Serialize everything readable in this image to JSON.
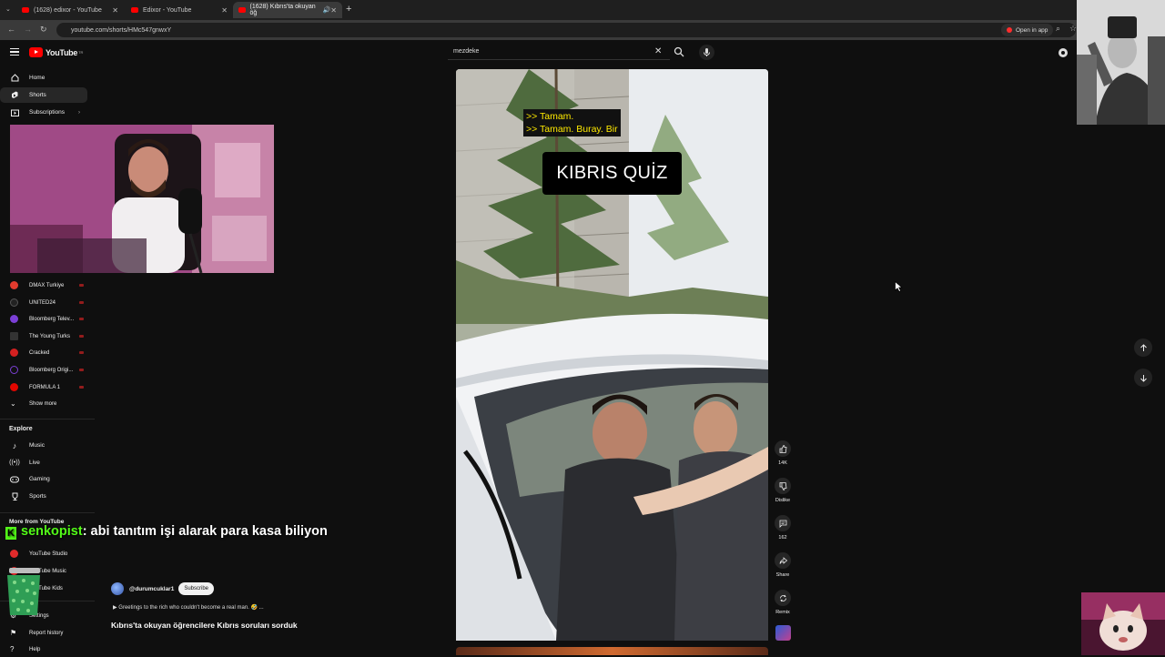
{
  "browser": {
    "tabs": [
      {
        "label": "(1628) edixor - YouTube"
      },
      {
        "label": "Edixor - YouTube"
      },
      {
        "label": "(1628) Kıbrıs'ta okuyan öğ"
      }
    ],
    "url": "youtube.com/shorts/HMc547gnwxY",
    "open_in_app": "Open in app"
  },
  "header": {
    "logo": "YouTube",
    "logo_region": "TR",
    "search_value": "mezdeke"
  },
  "sidebar": {
    "main": [
      {
        "label": "Home",
        "icon": "home-icon"
      },
      {
        "label": "Shorts",
        "icon": "shorts-icon"
      },
      {
        "label": "Subscriptions",
        "icon": "subscriptions-icon"
      }
    ],
    "subscriptions": [
      {
        "label": "DMAX Turkiye",
        "color": "#e23b2e"
      },
      {
        "label": "UNITED24",
        "color": "#222222"
      },
      {
        "label": "Bloomberg Telev...",
        "color": "#7b3fd6"
      },
      {
        "label": "The Young Turks",
        "color": "#333333"
      },
      {
        "label": "Cracked",
        "color": "#d32020"
      },
      {
        "label": "Bloomberg Origi...",
        "color": "#111111"
      },
      {
        "label": "FORMULA 1",
        "color": "#e10600"
      }
    ],
    "show_more": "Show more",
    "explore_heading": "Explore",
    "explore": [
      {
        "label": "Music",
        "icon": "music-icon"
      },
      {
        "label": "Live",
        "icon": "live-icon"
      },
      {
        "label": "Gaming",
        "icon": "gaming-icon"
      },
      {
        "label": "Sports",
        "icon": "trophy-icon"
      }
    ],
    "more_heading": "More from YouTube",
    "more": [
      {
        "label": "YouTube Studio"
      },
      {
        "label": "YouTube Music"
      },
      {
        "label": "YouTube Kids"
      }
    ],
    "settings": "Settings",
    "report_history": "Report history",
    "help": "Help"
  },
  "chat": {
    "username": "senkopist",
    "message": ": abi tanıtım işi alarak para kasa biliyon"
  },
  "short": {
    "caption_text": ">> Tamam.\n>> Tamam. Buray. Bir",
    "overlay_title": "KIBRIS QUİZ",
    "channel": "@durumcuklar1",
    "subscribe": "Subscribe",
    "description": "▶ Greetings to the rich who couldn't become a real man. 🤣 ...",
    "title": "Kıbrıs'ta okuyan öğrencilere Kıbrıs soruları sorduk"
  },
  "actions": {
    "like_count": "14K",
    "dislike_label": "Dislike",
    "comment_count": "162",
    "share_label": "Share",
    "remix_label": "Remix"
  },
  "colors": {
    "youtube_red": "#ff0000",
    "kick_green": "#53fc18",
    "caption_yellow": "#ffea00"
  }
}
